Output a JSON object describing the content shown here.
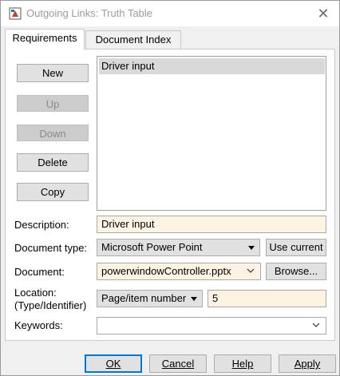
{
  "window": {
    "title": "Outgoing Links: Truth Table",
    "close_glyph": "✕"
  },
  "tabs": [
    {
      "label": "Requirements",
      "active": true
    },
    {
      "label": "Document Index",
      "active": false
    }
  ],
  "side_buttons": {
    "new": "New",
    "up": "Up",
    "down": "Down",
    "delete": "Delete",
    "copy": "Copy"
  },
  "requirements_list": [
    "Driver input"
  ],
  "form": {
    "description_label": "Description:",
    "description_value": "Driver input",
    "doc_type_label": "Document type:",
    "doc_type_value": "Microsoft Power Point",
    "use_current_label": "Use current",
    "document_label": "Document:",
    "document_value": "powerwindowController.pptx",
    "browse_label": "Browse...",
    "location_label_1": "Location:",
    "location_label_2": "(Type/Identifier)",
    "location_type_value": "Page/item number",
    "location_id_value": "5",
    "keywords_label": "Keywords:",
    "keywords_value": ""
  },
  "footer": {
    "ok": "OK",
    "cancel": "Cancel",
    "help": "Help",
    "apply": "Apply"
  },
  "icons": {
    "app": "simulink-link-icon",
    "close": "close-icon",
    "dropdown": "caret-down-icon",
    "combo": "chevron-down-icon"
  },
  "colors": {
    "editable_field_bg": "#fdf3e3",
    "selected_row": "#d9d9d9",
    "default_button_border": "#0078d7"
  }
}
